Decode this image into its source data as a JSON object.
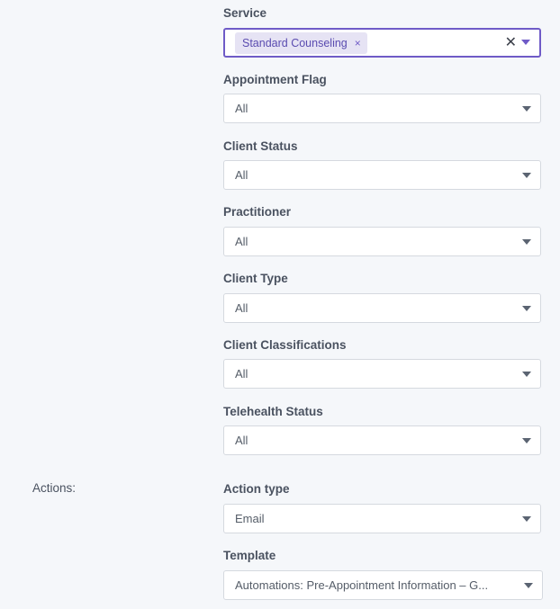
{
  "service": {
    "label": "Service",
    "tag": "Standard Counseling",
    "tag_remove": "×",
    "clear": "✕"
  },
  "filters": [
    {
      "label": "Appointment Flag",
      "value": "All"
    },
    {
      "label": "Client Status",
      "value": "All"
    },
    {
      "label": "Practitioner",
      "value": "All"
    },
    {
      "label": "Client Type",
      "value": "All"
    },
    {
      "label": "Client Classifications",
      "value": "All"
    },
    {
      "label": "Telehealth Status",
      "value": "All"
    }
  ],
  "actions": {
    "section_label": "Actions:",
    "action_type": {
      "label": "Action type",
      "value": "Email"
    },
    "template": {
      "label": "Template",
      "value": "Automations: Pre-Appointment Information – G..."
    }
  },
  "colors": {
    "accent": "#6f5bc7",
    "tag_bg": "#e6e3f4",
    "background": "#f5f7fa",
    "border": "#d5d9df"
  }
}
